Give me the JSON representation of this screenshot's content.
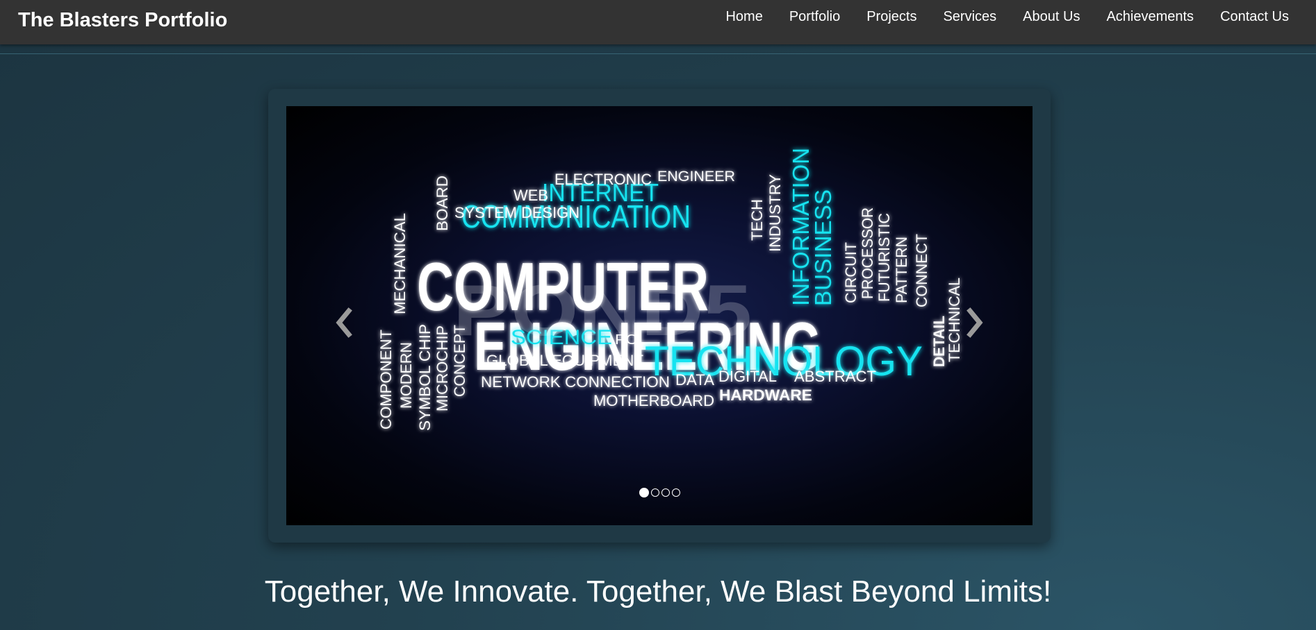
{
  "header": {
    "brand": "The Blasters Portfolio",
    "nav": [
      "Home",
      "Portfolio",
      "Projects",
      "Services",
      "About Us",
      "Achievements",
      "Contact Us"
    ]
  },
  "carousel": {
    "slide_count": 4,
    "active_slide": 1,
    "word_cloud": {
      "big": [
        "COMPUTER",
        "ENGINEERING"
      ],
      "cyan": [
        "COMMUNICATION",
        "INTERNET",
        "TECHNOLOGY",
        "SCIENCE",
        "INFORMATION",
        "BUSINESS"
      ],
      "white": [
        "WEB",
        "ELECTRONIC",
        "ENGINEER",
        "SYSTEM DESIGN",
        "BOARD",
        "MECHANICAL",
        "TECH",
        "INDUSTRY",
        "CIRCUIT",
        "PROCESSOR",
        "FUTURISTIC",
        "PATTERN",
        "CONNECT",
        "DETAIL",
        "TECHNICAL",
        "COMPONENT",
        "MODERN",
        "SYMBOL CHIP",
        "MICROCHIP",
        "CONCEPT",
        "PC",
        "GLOBAL EQUIPMENT",
        "NETWORK CONNECTION",
        "DATA",
        "DIGITAL",
        "ABSTRACT",
        "HARDWARE",
        "MOTHERBOARD"
      ],
      "watermark": "POND5"
    },
    "colors": {
      "cyan": "#17e3f0",
      "white": "#ffffff"
    },
    "icons": {
      "prev": "chevron-left-icon",
      "next": "chevron-right-icon"
    }
  },
  "tagline": "Together, We Innovate. Together, We Blast Beyond Limits!"
}
